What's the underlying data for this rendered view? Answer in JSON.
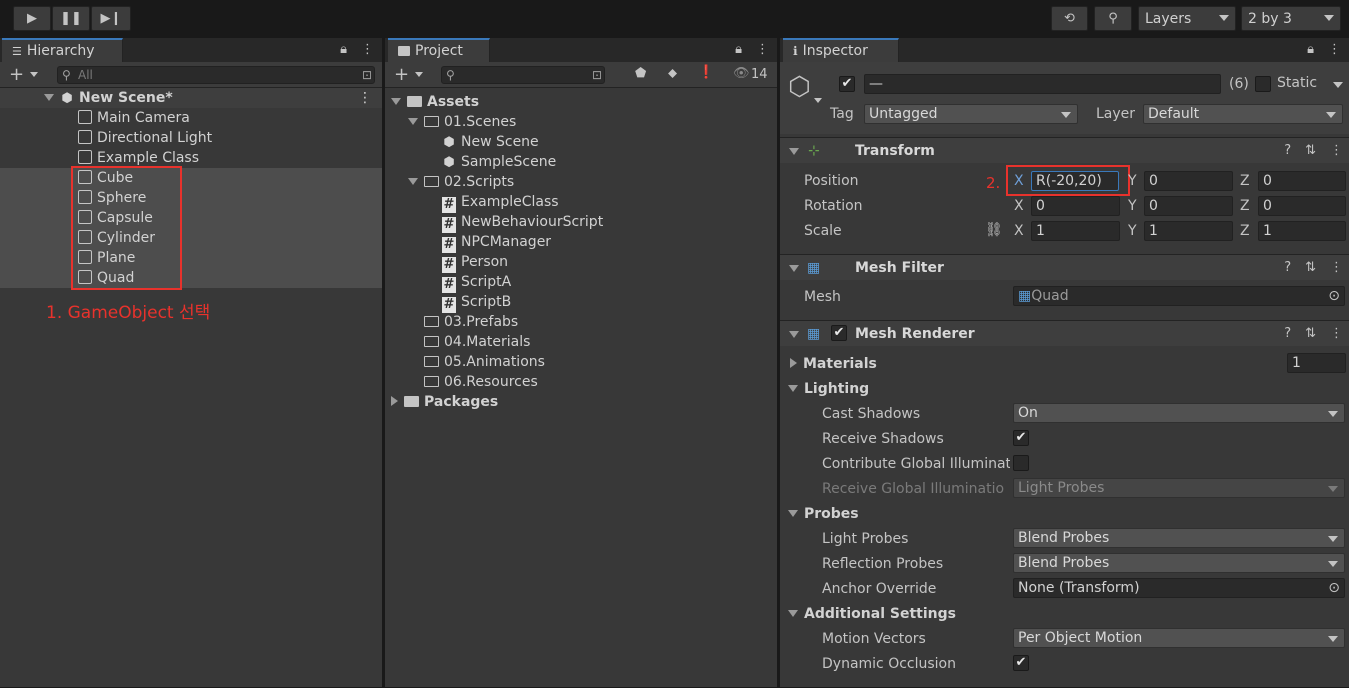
{
  "toolbar": {
    "layers_label": "Layers",
    "layout_label": "2 by 3"
  },
  "hierarchy": {
    "tab": "Hierarchy",
    "search_placeholder": "All",
    "scene_name": "New Scene*",
    "items": [
      "Main Camera",
      "Directional Light",
      "Example Class",
      "Cube",
      "Sphere",
      "Capsule",
      "Cylinder",
      "Plane",
      "Quad"
    ],
    "annotation": "1. GameObject 선택"
  },
  "project": {
    "tab": "Project",
    "visibility_count": "14",
    "assets": "Assets",
    "scenes_folder": "01.Scenes",
    "scenes": [
      "New Scene",
      "SampleScene"
    ],
    "scripts_folder": "02.Scripts",
    "scripts": [
      "ExampleClass",
      "NewBehaviourScript",
      "NPCManager",
      "Person",
      "ScriptA",
      "ScriptB"
    ],
    "folders": [
      "03.Prefabs",
      "04.Materials",
      "05.Animations",
      "06.Resources"
    ],
    "packages": "Packages"
  },
  "inspector": {
    "tab": "Inspector",
    "name_value": "—",
    "count": "(6)",
    "static_label": "Static",
    "tag_label": "Tag",
    "tag_value": "Untagged",
    "layer_label": "Layer",
    "layer_value": "Default",
    "transform": {
      "title": "Transform",
      "position_label": "Position",
      "rotation_label": "Rotation",
      "scale_label": "Scale",
      "annotation": "2.",
      "position": {
        "x": "R(-20,20)",
        "y": "0",
        "z": "0"
      },
      "rotation": {
        "x": "0",
        "y": "0",
        "z": "0"
      },
      "scale": {
        "x": "1",
        "y": "1",
        "z": "1"
      },
      "axis_x": "X",
      "axis_y": "Y",
      "axis_z": "Z"
    },
    "mesh_filter": {
      "title": "Mesh Filter",
      "mesh_label": "Mesh",
      "mesh_value": "Quad"
    },
    "mesh_renderer": {
      "title": "Mesh Renderer",
      "materials_label": "Materials",
      "materials_count": "1",
      "lighting_label": "Lighting",
      "cast_shadows_label": "Cast Shadows",
      "cast_shadows_value": "On",
      "receive_shadows_label": "Receive Shadows",
      "contribute_gi_label": "Contribute Global Illuminat",
      "receive_gi_label": "Receive Global Illuminatio",
      "receive_gi_value": "Light Probes",
      "probes_label": "Probes",
      "light_probes_label": "Light Probes",
      "light_probes_value": "Blend Probes",
      "reflection_probes_label": "Reflection Probes",
      "reflection_probes_value": "Blend Probes",
      "anchor_override_label": "Anchor Override",
      "anchor_override_value": "None (Transform)",
      "additional_label": "Additional Settings",
      "motion_vectors_label": "Motion Vectors",
      "motion_vectors_value": "Per Object Motion",
      "dynamic_occlusion_label": "Dynamic Occlusion"
    }
  },
  "colors": {
    "accent": "#3a79bb",
    "annotation_red": "#e8322c",
    "selected_row": "#4d4d4d",
    "panel": "#383838"
  }
}
